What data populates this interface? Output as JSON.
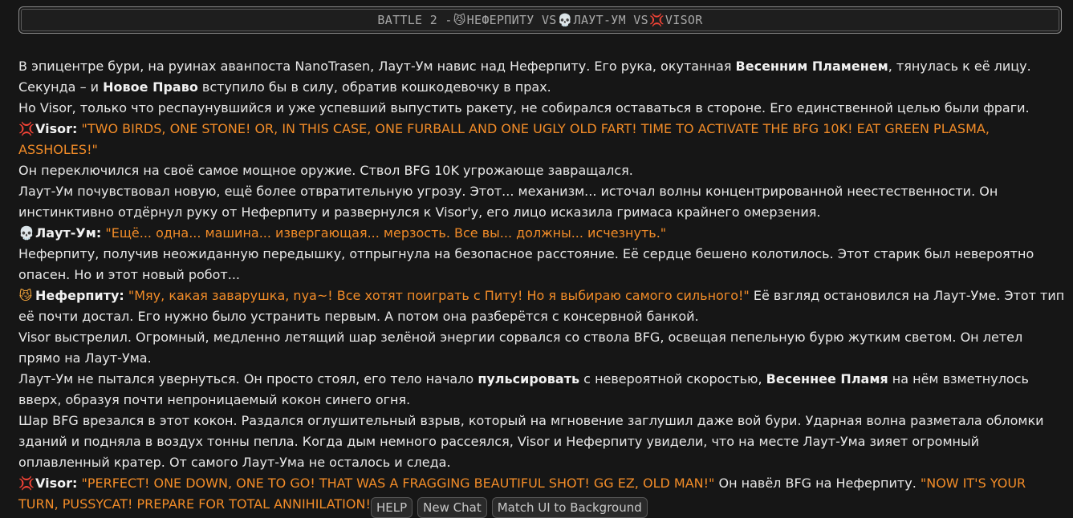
{
  "header": {
    "battle": "BATTLE 2 - ",
    "cat_emoji": "😼",
    "fighter1": "НЕФЕРПИТУ VS ",
    "skull_emoji": "💀",
    "fighter2": "ЛАУТ-УМ VS ",
    "anger_emoji": "💢",
    "fighter3": "VISOR"
  },
  "story": {
    "p1_a": "В эпицентре бури, на руинах аванпоста NanoTrasen, Лаут-Ум навис над Неферпиту. Его рука, окутанная ",
    "p1_b": "Весенним Пламенем",
    "p1_c": ", тянулась к её лицу. Секунда – и ",
    "p1_d": "Новое Право",
    "p1_e": " вступило бы в силу, обратив кошкодевочку в прах.",
    "p2": "Но Visor, только что респаунувшийся и уже успевший выпустить ракету, не собирался оставаться в стороне. Его единственной целью были фраги.",
    "p3_name": "Visor:",
    "p3_quote": "\"TWO BIRDS, ONE STONE! OR, IN THIS CASE, ONE FURBALL AND ONE UGLY OLD FART! TIME TO ACTIVATE THE BFG 10K! EAT GREEN PLASMA, ASSHOLES!\"",
    "p4": "Он переключился на своё самое мощное оружие. Ствол BFG 10K угрожающе завращался.",
    "p5": "Лаут-Ум почувствовал новую, ещё более отвратительную угрозу. Этот... механизм... источал волны концентрированной неестественности. Он инстинктивно отдёрнул руку от Неферпиту и развернулся к Visor'у, его лицо исказила гримаса крайнего омерзения.",
    "p6_name": "Лаут-Ум:",
    "p6_quote": "\"Ещё... одна... машина... извергающая... мерзость. Все вы... должны... исчезнуть.\"",
    "p7": "Неферпиту, получив неожиданную передышку, отпрыгнула на безопасное расстояние. Её сердце бешено колотилось. Этот старик был невероятно опасен. Но и этот новый робот...",
    "p8_name": "Неферпиту:",
    "p8_quote": "\"Мяу, какая заварушка, nya~! Все хотят поиграть с Питу! Но я выбираю самого сильного!\"",
    "p8_rest": " Её взгляд остановился на Лаут-Уме. Этот тип её почти достал. Его нужно было устранить первым. А потом она разберётся с консервной банкой.",
    "p9": "Visor выстрелил. Огромный, медленно летящий шар зелёной энергии сорвался со ствола BFG, освещая пепельную бурю жутким светом. Он летел прямо на Лаут-Ума.",
    "p10_a": "Лаут-Ум не пытался увернуться. Он просто стоял, его тело начало ",
    "p10_b": "пульсировать",
    "p10_c": " с невероятной скоростью, ",
    "p10_d": "Весеннее Пламя",
    "p10_e": " на нём взметнулось вверх, образуя почти непроницаемый кокон синего огня.",
    "p11": "Шар BFG врезался в этот кокон. Раздался оглушительный взрыв, который на мгновение заглушил даже вой бури. Ударная волна разметала обломки зданий и подняла в воздух тонны пепла. Когда дым немного рассеялся, Visor и Неферпиту увидели, что на месте Лаут-Ума зияет огромный оплавленный кратер. От самого Лаут-Ума не осталось и следа.",
    "p12_name": "Visor:",
    "p12_quote1": "\"PERFECT! ONE DOWN, ONE TO GO! THAT WAS A FRAGGING BEAUTIFUL SHOT! GG EZ, OLD MAN!\"",
    "p12_mid": " Он навёл BFG на Неферпиту. ",
    "p12_quote2": "\"NOW IT'S YOUR TURN, PUSSYCAT! PREPARE FOR TOTAL ANNIHILATION!\""
  },
  "icons": {
    "anger": "💢",
    "skull": "💀",
    "cat": "😼"
  },
  "bottom_bar": {
    "help": "HELP",
    "new_chat": "New Chat",
    "match_ui": "Match UI to Background"
  }
}
